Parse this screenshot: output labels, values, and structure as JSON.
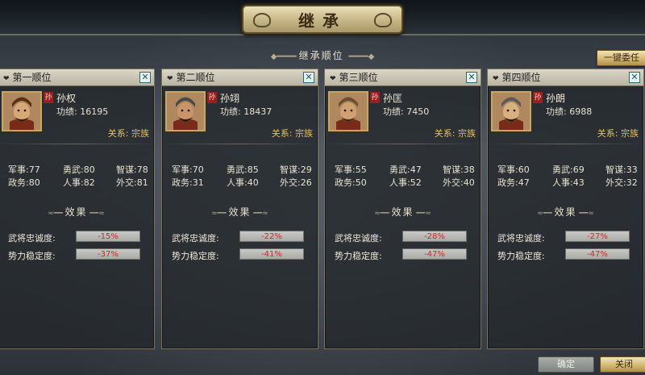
{
  "window": {
    "title": "继承"
  },
  "header": {
    "subtitle": "继承顺位",
    "top_button": "一键委任"
  },
  "labels": {
    "merit_prefix": "功绩: ",
    "military": "军事:",
    "bravery": "勇武:",
    "strategy": "智谋:",
    "politics": "政务:",
    "personnel": "人事:",
    "diplomacy": "外交:",
    "effects_title": "效果",
    "loyalty": "武将忠诚度:",
    "stability": "势力稳定度:",
    "clan_badge": "孙"
  },
  "candidates": [
    {
      "rank": "第一顺位",
      "name": "孙权",
      "merit": "功绩: 16195",
      "relation": "关系: 宗族",
      "stats": {
        "military": "77",
        "bravery": "80",
        "strategy": "78",
        "politics": "80",
        "personnel": "82",
        "diplomacy": "81"
      },
      "loyalty_effect": "-15%",
      "stability_effect": "-37%",
      "portrait_icon": "general-portrait-icon"
    },
    {
      "rank": "第二顺位",
      "name": "孙翊",
      "merit": "功绩: 18437",
      "relation": "关系: 宗族",
      "stats": {
        "military": "70",
        "bravery": "85",
        "strategy": "29",
        "politics": "31",
        "personnel": "40",
        "diplomacy": "26"
      },
      "loyalty_effect": "-22%",
      "stability_effect": "-41%",
      "portrait_icon": "general-portrait-icon"
    },
    {
      "rank": "第三顺位",
      "name": "孙匡",
      "merit": "功绩: 7450",
      "relation": "关系: 宗族",
      "stats": {
        "military": "55",
        "bravery": "47",
        "strategy": "38",
        "politics": "50",
        "personnel": "52",
        "diplomacy": "40"
      },
      "loyalty_effect": "-28%",
      "stability_effect": "-47%",
      "portrait_icon": "general-portrait-icon"
    },
    {
      "rank": "第四顺位",
      "name": "孙朗",
      "merit": "功绩: 6988",
      "relation": "关系: 宗族",
      "stats": {
        "military": "60",
        "bravery": "69",
        "strategy": "33",
        "politics": "47",
        "personnel": "43",
        "diplomacy": "32"
      },
      "loyalty_effect": "-27%",
      "stability_effect": "-47%",
      "portrait_icon": "general-portrait-icon"
    }
  ],
  "footer": {
    "confirm": "确定",
    "close": "关闭"
  },
  "colors": {
    "accent_gold": "#e4c060",
    "negative": "#e02020",
    "badge_red": "#9c1e1e"
  }
}
